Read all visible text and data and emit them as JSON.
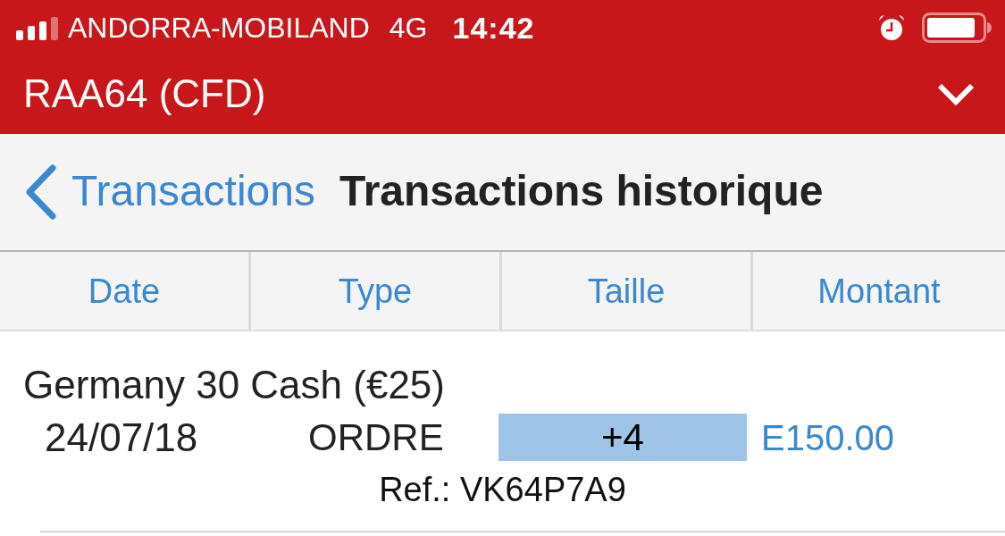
{
  "status_bar": {
    "carrier": "ANDORRA-MOBILAND",
    "network": "4G",
    "time": "14:42"
  },
  "account_bar": {
    "title": "RAA64 (CFD)"
  },
  "nav_bar": {
    "back_label": "Transactions",
    "title": "Transactions historique"
  },
  "table": {
    "columns": [
      "Date",
      "Type",
      "Taille",
      "Montant"
    ],
    "rows": [
      {
        "instrument": "Germany 30 Cash (€25)",
        "date": "24/07/18",
        "type": "ORDRE",
        "size": "+4",
        "amount": "E150.00",
        "ref": "Ref.: VK64P7A9"
      }
    ]
  }
}
